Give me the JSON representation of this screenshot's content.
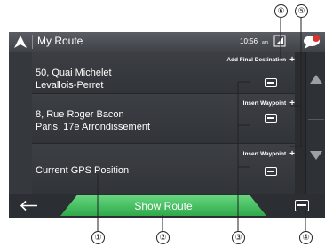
{
  "header": {
    "title": "My Route",
    "clock": "10:56",
    "ampm": "am"
  },
  "route_items": [
    {
      "line1": "50, Quai Michelet",
      "line2": "Levallois-Perret",
      "action": "Add Final Destination"
    },
    {
      "line1": "8, Rue Roger Bacon",
      "line2": "Paris, 17e Arrondissement",
      "action": "Insert Waypoint"
    },
    {
      "line1": "Current GPS Position",
      "line2": "",
      "action": "Insert Waypoint"
    }
  ],
  "footer": {
    "show_route_label": "Show Route"
  },
  "callouts": [
    "①",
    "②",
    "③",
    "④",
    "⑤",
    "⑥"
  ],
  "colors": {
    "accent_green": "#3fbf5c",
    "background": "#3a3d42"
  },
  "icons": {
    "nav": "navigation-arrow-icon",
    "finish": "checkered-flag-icon",
    "waypoint": "waypoint-dot-icon",
    "start": "current-position-arrow-icon",
    "menu": "menu-icon",
    "back": "back-arrow-icon",
    "add": "plus-icon",
    "scroll_up": "scroll-up-icon",
    "scroll_down": "scroll-down-icon"
  }
}
